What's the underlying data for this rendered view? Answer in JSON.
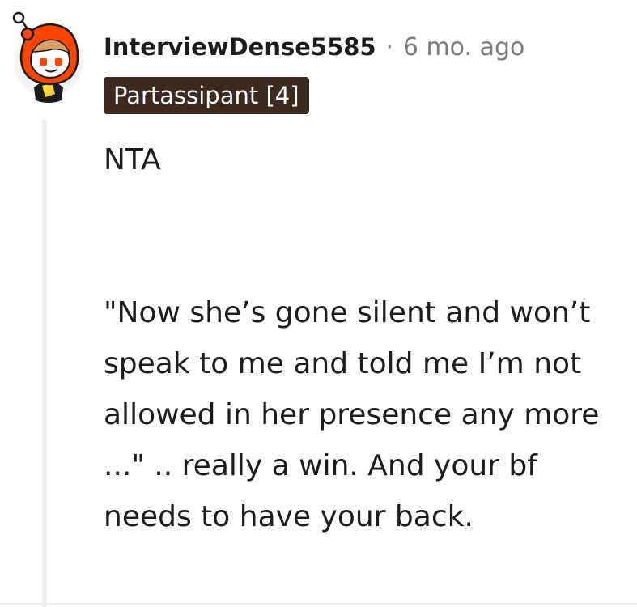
{
  "comment": {
    "avatar_icon": "snoo-avatar-icon",
    "username": "InterviewDense5585",
    "separator": "·",
    "timestamp": "6 mo. ago",
    "flair": "Partassipant [4]",
    "body": {
      "paragraph_1": "NTA",
      "paragraph_2": "\"Now she’s gone silent and won’t speak to me and told me I’m not allowed in her presence any more ...\" .. really a win. And your bf needs to have your back."
    }
  },
  "colors": {
    "flair_background": "#3d2a1f",
    "avatar_hood": "#ff4500",
    "text_primary": "#1c1c1c",
    "text_muted": "#7c7c7c",
    "thread_line": "#edeff1"
  }
}
